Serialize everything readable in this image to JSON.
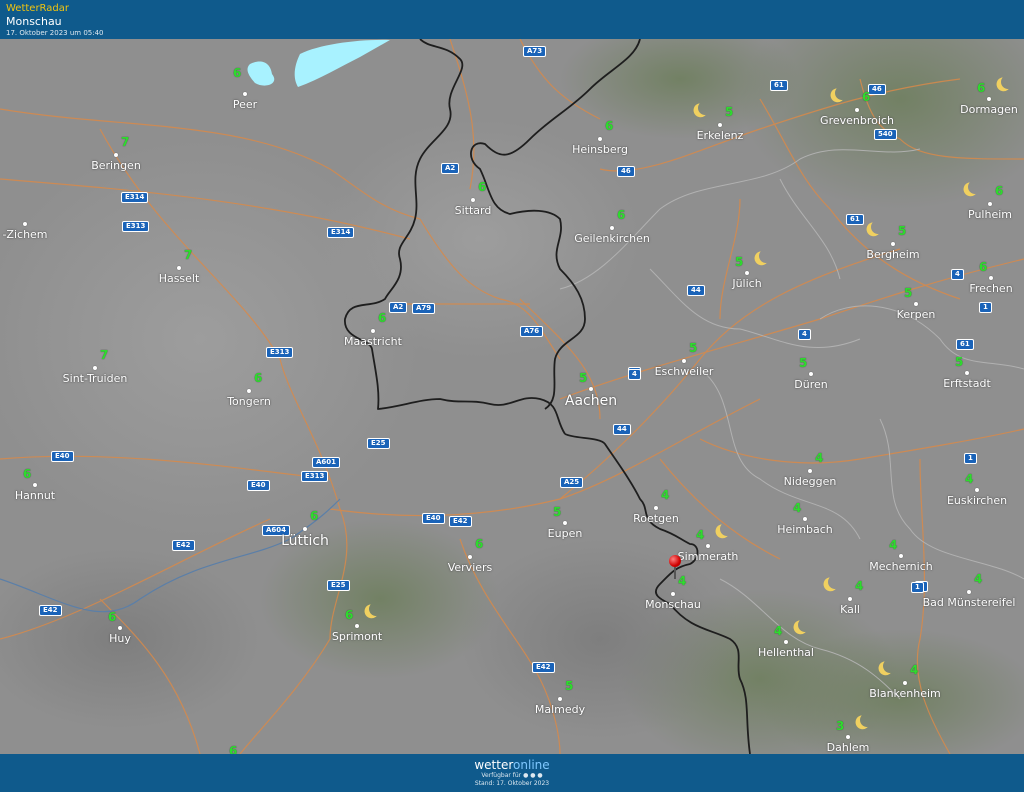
{
  "header": {
    "app_name": "WetterRadar",
    "location": "Monschau",
    "datetime": "17. Oktober 2023 um 05:40"
  },
  "footer": {
    "brand_a": "wetter",
    "brand_b": "online",
    "availability": "Verfügbar für",
    "stand": "Stand: 17. Oktober 2023"
  },
  "colors": {
    "bar": "#0f5a8c",
    "temp": "#2ddc2d",
    "accent": "#f1c40f"
  },
  "cities": [
    {
      "name": "Peer",
      "temp": "6"
    },
    {
      "name": "Beringen",
      "temp": "7"
    },
    {
      "name": "-Zichem",
      "temp": ""
    },
    {
      "name": "Hasselt",
      "temp": "7"
    },
    {
      "name": "Sint-Truiden",
      "temp": "7"
    },
    {
      "name": "Tongern",
      "temp": "6"
    },
    {
      "name": "Hannut",
      "temp": "6"
    },
    {
      "name": "Lüttich",
      "temp": "6"
    },
    {
      "name": "Huy",
      "temp": "6"
    },
    {
      "name": "Sprimont",
      "temp": "6"
    },
    {
      "name": "Verviers",
      "temp": "6"
    },
    {
      "name": "Malmedy",
      "temp": "5"
    },
    {
      "name": "Eupen",
      "temp": "5"
    },
    {
      "name": "Maastricht",
      "temp": "6"
    },
    {
      "name": "Sittard",
      "temp": "6"
    },
    {
      "name": "Heinsberg",
      "temp": "6"
    },
    {
      "name": "Geilenkirchen",
      "temp": "6"
    },
    {
      "name": "Aachen",
      "temp": "5"
    },
    {
      "name": "Roetgen",
      "temp": "4"
    },
    {
      "name": "Simmerath",
      "temp": "4"
    },
    {
      "name": "Monschau",
      "temp": "4"
    },
    {
      "name": "Erkelenz",
      "temp": "5"
    },
    {
      "name": "Jülich",
      "temp": "5"
    },
    {
      "name": "Eschweiler",
      "temp": "5"
    },
    {
      "name": "Düren",
      "temp": "5"
    },
    {
      "name": "Nideggen",
      "temp": "4"
    },
    {
      "name": "Heimbach",
      "temp": "4"
    },
    {
      "name": "Hellenthal",
      "temp": "4"
    },
    {
      "name": "Kall",
      "temp": "4"
    },
    {
      "name": "Mechernich",
      "temp": "4"
    },
    {
      "name": "Blankenheim",
      "temp": "4"
    },
    {
      "name": "Dahlem",
      "temp": "3"
    },
    {
      "name": "Grevenbroich",
      "temp": "6"
    },
    {
      "name": "Dormagen",
      "temp": "6"
    },
    {
      "name": "Pulheim",
      "temp": "6"
    },
    {
      "name": "Bergheim",
      "temp": "5"
    },
    {
      "name": "Frechen",
      "temp": "6"
    },
    {
      "name": "Kerpen",
      "temp": "5"
    },
    {
      "name": "Erftstadt",
      "temp": "5"
    },
    {
      "name": "Euskirchen",
      "temp": "4"
    },
    {
      "name": "Bad Münstereifel",
      "temp": "4"
    }
  ],
  "stray_temp": "6",
  "roads": [
    "A73",
    "61",
    "46",
    "540",
    "A2",
    "46",
    "E314",
    "E313",
    "E314",
    "61",
    "A2",
    "A79",
    "A76",
    "44",
    "4",
    "4",
    "E313",
    "E25",
    "A601",
    "E313",
    "E40",
    "E40",
    "A25",
    "A604",
    "E40",
    "E42",
    "E42",
    "E25",
    "E42",
    "E42",
    "44",
    "1",
    "1",
    "1",
    "61",
    "4",
    "4",
    "1"
  ],
  "icons": {
    "pin": "location-pin-icon",
    "moon": "moon-icon"
  }
}
